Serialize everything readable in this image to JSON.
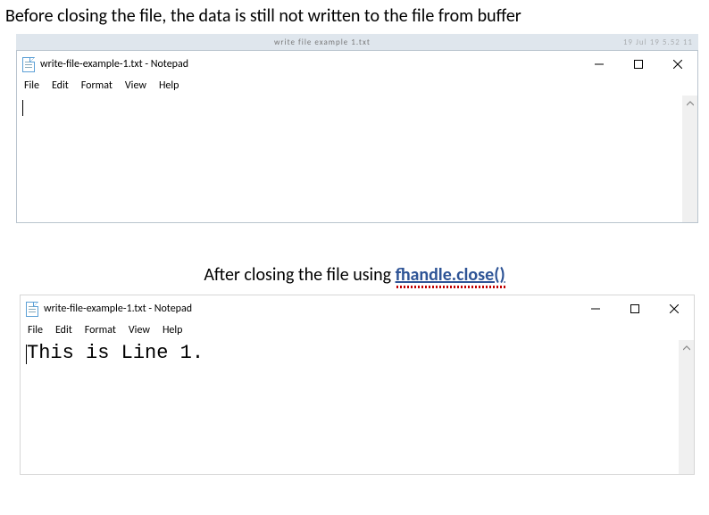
{
  "captions": {
    "before": "Before closing the file, the data is still not written to the file from buffer",
    "after_prefix": "After closing the file using ",
    "after_code": "fhandle.close()"
  },
  "frame_decor": {
    "left": "",
    "middle": "write file example 1.txt",
    "right": "19 Jul 19 5.52 11"
  },
  "notepad1": {
    "title": "write-file-example-1.txt - Notepad",
    "menus": {
      "file": "File",
      "edit": "Edit",
      "format": "Format",
      "view": "View",
      "help": "Help"
    },
    "content": ""
  },
  "notepad2": {
    "title": "write-file-example-1.txt - Notepad",
    "menus": {
      "file": "File",
      "edit": "Edit",
      "format": "Format",
      "view": "View",
      "help": "Help"
    },
    "content": "This is Line 1."
  }
}
